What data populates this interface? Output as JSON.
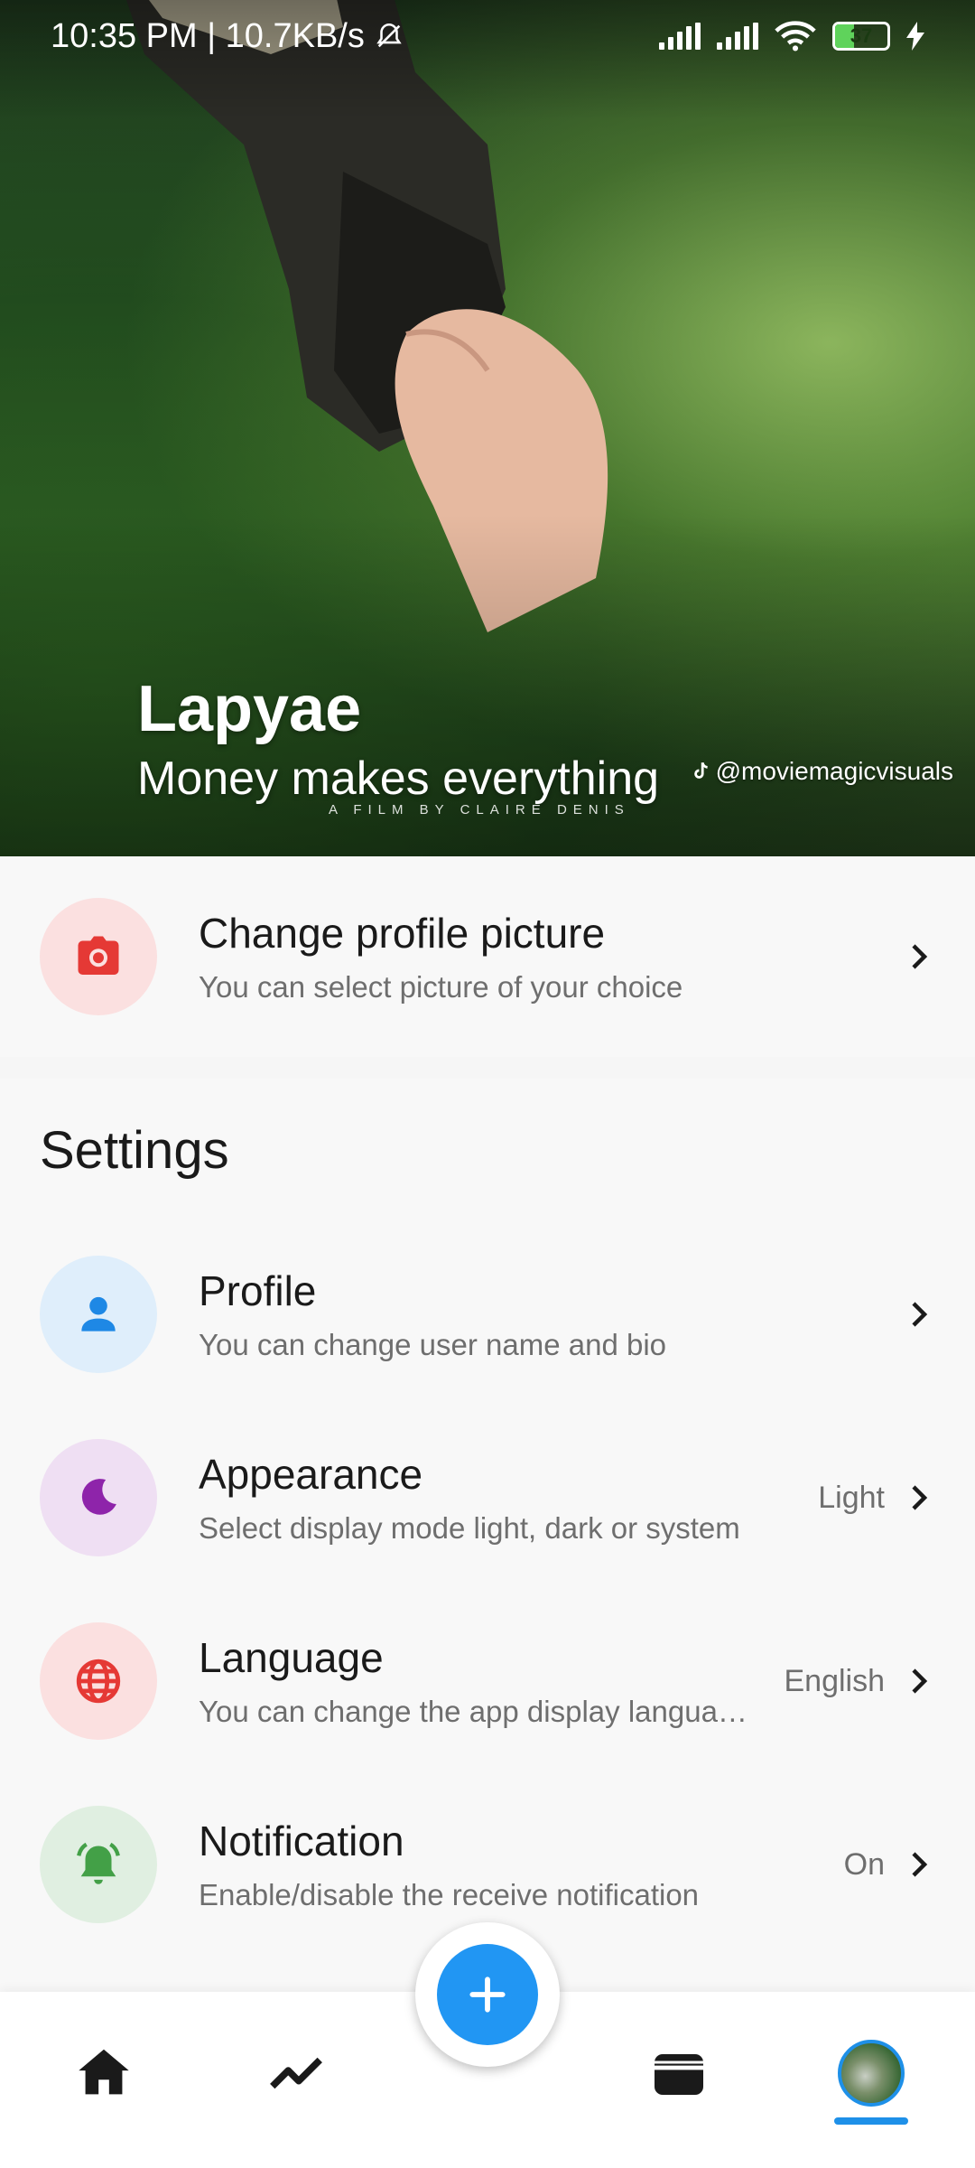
{
  "status_bar": {
    "time_speed": "10:35 PM | 10.7KB/s",
    "battery_level": "37"
  },
  "hero": {
    "name": "Lapyae",
    "bio": "Money makes everything",
    "film_credit": "A FILM BY CLAIRE DENIS",
    "watermark": "@moviemagicvisuals"
  },
  "change_picture": {
    "title": "Change profile picture",
    "subtitle": "You can select picture of your choice",
    "icon": "camera-icon",
    "color": "#e53935",
    "bg": "#fbe0e0"
  },
  "settings": {
    "section_title": "Settings",
    "items": [
      {
        "title": "Profile",
        "subtitle": "You can change user name and bio",
        "value": "",
        "icon": "person-icon",
        "color": "#1e88e5",
        "bg": "#dfeefb"
      },
      {
        "title": "Appearance",
        "subtitle": "Select display mode light, dark or system",
        "value": "Light",
        "icon": "moon-icon",
        "color": "#8e24aa",
        "bg": "#efdff3"
      },
      {
        "title": "Language",
        "subtitle": "You can change the app display language",
        "value": "English",
        "icon": "globe-icon",
        "color": "#e53935",
        "bg": "#fbe0e0"
      },
      {
        "title": "Notification",
        "subtitle": "Enable/disable the receive notification",
        "value": "On",
        "icon": "bell-icon",
        "color": "#43a047",
        "bg": "#e0efe1"
      }
    ]
  },
  "nav": {
    "items": [
      "home-icon",
      "trending-icon",
      "add-icon",
      "wallet-icon",
      "avatar"
    ],
    "active": "avatar",
    "accent": "#1e90e8"
  }
}
